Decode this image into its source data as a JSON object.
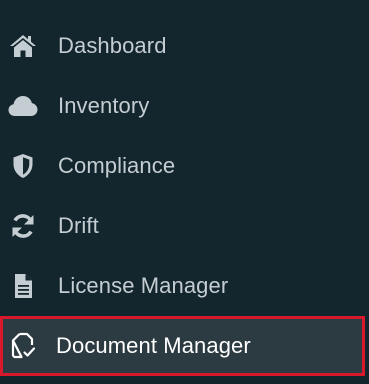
{
  "sidebar": {
    "items": [
      {
        "label": "Dashboard",
        "icon": "home-icon",
        "active": false
      },
      {
        "label": "Inventory",
        "icon": "cloud-icon",
        "active": false
      },
      {
        "label": "Compliance",
        "icon": "shield-icon",
        "active": false
      },
      {
        "label": "Drift",
        "icon": "sync-icon",
        "active": false
      },
      {
        "label": "License Manager",
        "icon": "document-icon",
        "active": false
      },
      {
        "label": "Document Manager",
        "icon": "document-check-icon",
        "active": true
      }
    ],
    "colors": {
      "background": "#14262d",
      "text": "#c4cdd1",
      "icon": "#c4cdd1",
      "active_background": "#2b3b41",
      "active_text": "#ffffff",
      "highlight_border": "#d7192b"
    }
  }
}
